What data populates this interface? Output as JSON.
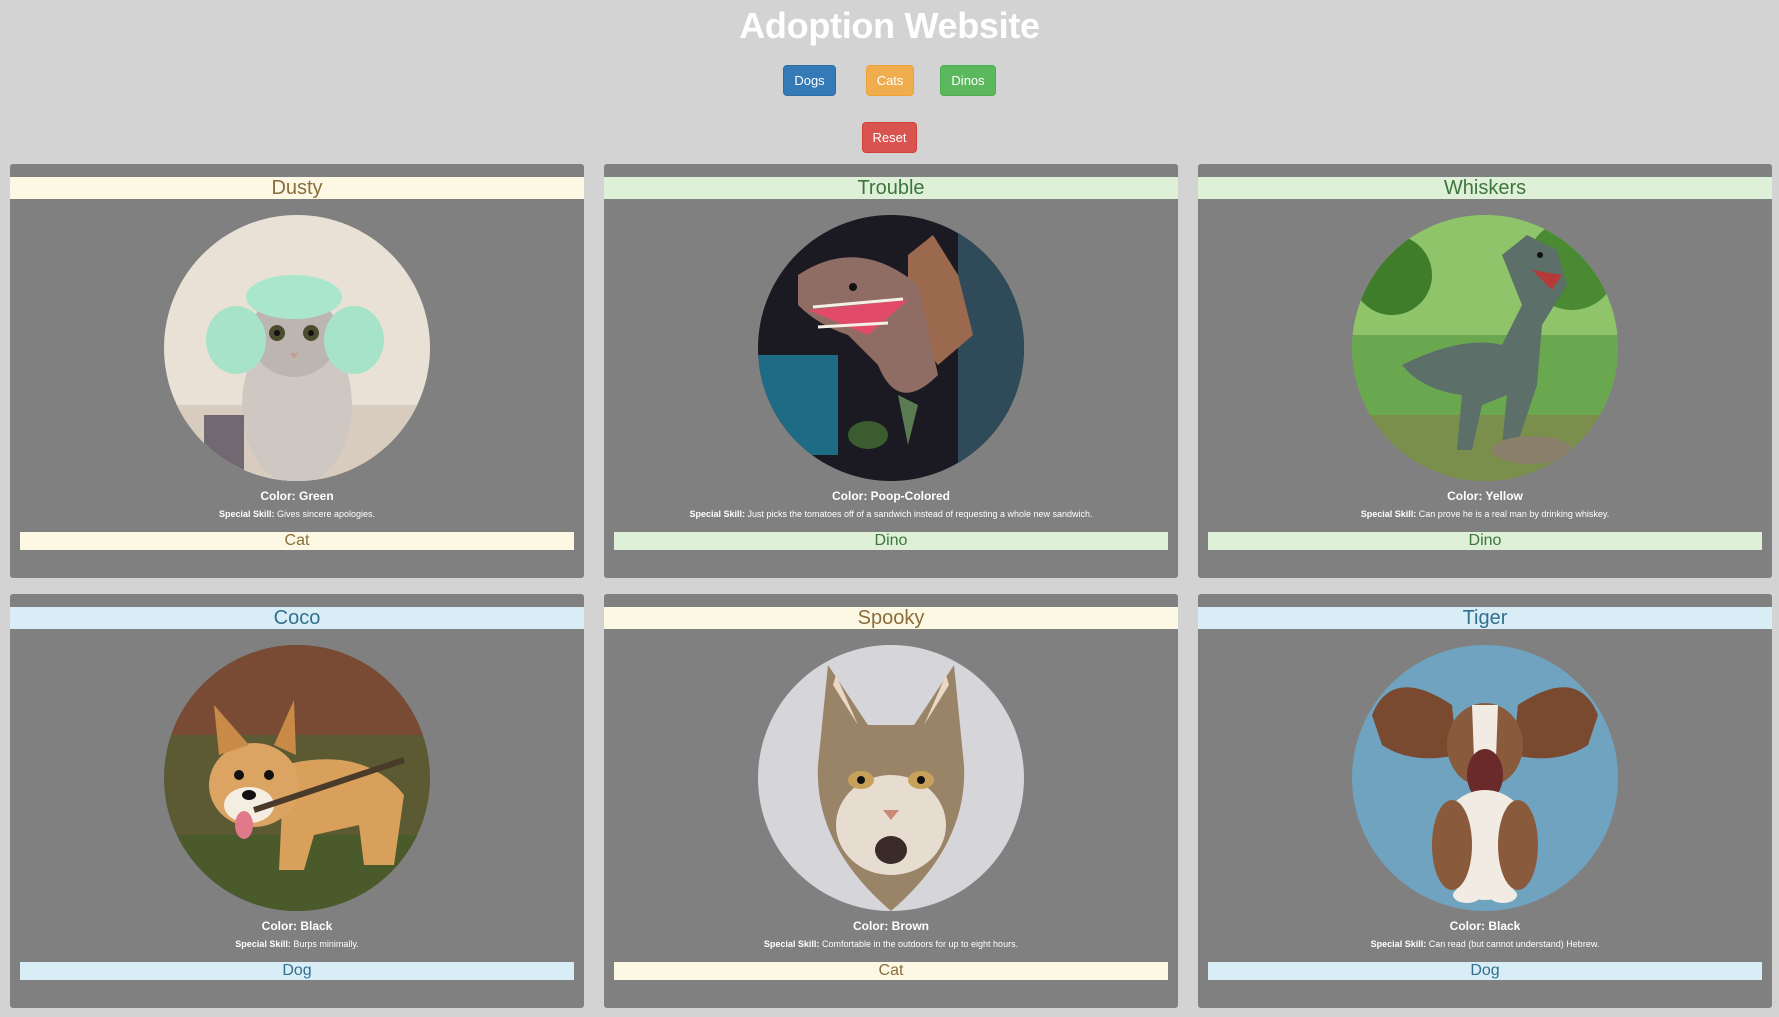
{
  "header": {
    "title": "Adoption Website"
  },
  "filters": {
    "dogs": "Dogs",
    "cats": "Cats",
    "dinos": "Dinos",
    "reset": "Reset"
  },
  "skill_prefix": "Special Skill:",
  "pets": [
    {
      "name": "Dusty",
      "color": "Color: Green",
      "skill": "Gives sincere apologies.",
      "type": "Cat"
    },
    {
      "name": "Trouble",
      "color": "Color: Poop-Colored",
      "skill": "Just picks the tomatoes off of a sandwich instead of requesting a whole new sandwich.",
      "type": "Dino"
    },
    {
      "name": "Whiskers",
      "color": "Color: Yellow",
      "skill": "Can prove he is a real man by drinking whiskey.",
      "type": "Dino"
    },
    {
      "name": "Coco",
      "color": "Color: Black",
      "skill": "Burps minimally.",
      "type": "Dog"
    },
    {
      "name": "Spooky",
      "color": "Color: Brown",
      "skill": "Comfortable in the outdoors for up to eight hours.",
      "type": "Cat"
    },
    {
      "name": "Tiger",
      "color": "Color: Black",
      "skill": "Can read (but cannot understand) Hebrew.",
      "type": "Dog"
    }
  ],
  "colors": {
    "page_bg": "#d3d3d3",
    "card_bg": "#808080",
    "cat_band": "#fcf8e3",
    "dino_band": "#dff0d8",
    "dog_band": "#d9edf7"
  }
}
